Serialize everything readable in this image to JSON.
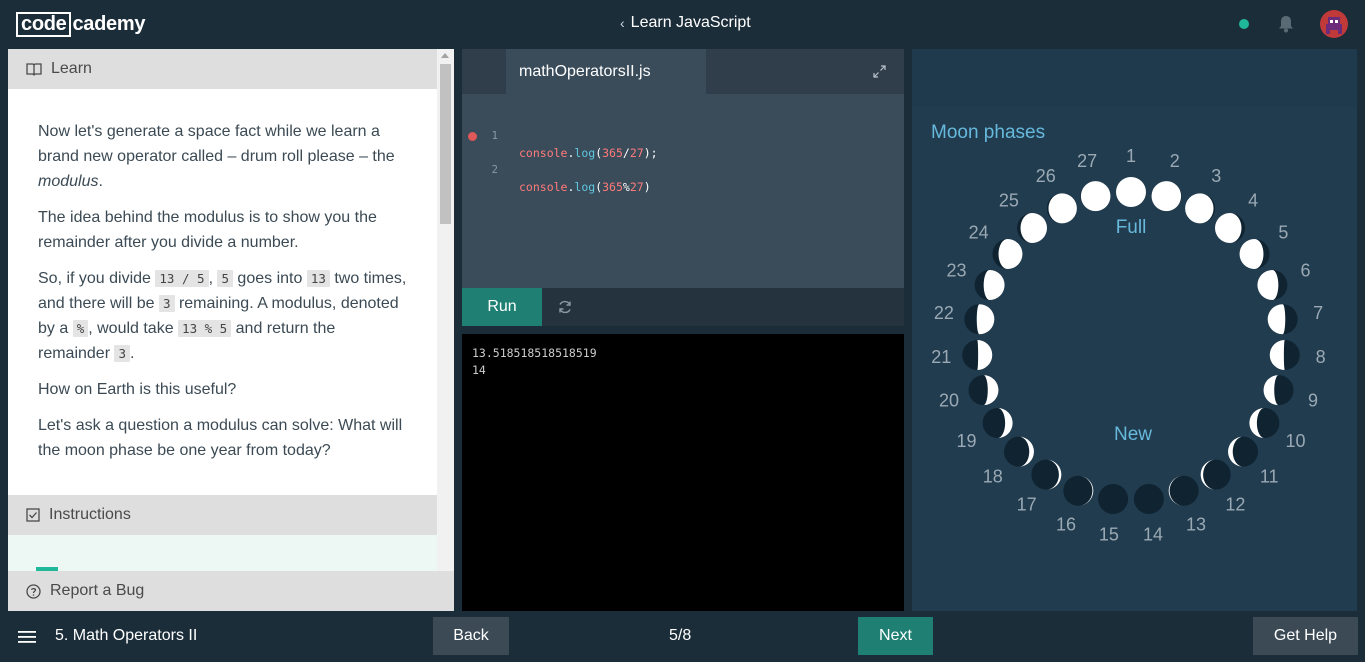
{
  "header": {
    "logo_left": "code",
    "logo_right": "cademy",
    "course_title": "Learn JavaScript"
  },
  "colors": {
    "accent": "#1e7f72",
    "status": "#1fb898",
    "moon_label": "#67b9dc"
  },
  "icons": {
    "back": "chevron-left-icon",
    "bell": "bell-icon",
    "learn": "book-icon",
    "instructions": "checkbox-icon",
    "report": "question-circle-icon",
    "expand": "expand-icon",
    "reset": "refresh-icon",
    "menu": "hamburger-icon"
  },
  "learn": {
    "header": "Learn",
    "p1_a": "Now let's generate a space fact while we learn a brand new operator called – drum roll please – the ",
    "p1_em": "modulus",
    "p1_b": ".",
    "p2": "The idea behind the modulus is to show you the remainder after you divide a number.",
    "p3_a": "So, if you divide ",
    "p3_c1": "13 / 5",
    "p3_b": ", ",
    "p3_c2": "5",
    "p3_c": " goes into ",
    "p3_c3": "13",
    "p3_d": " two times, and there will be ",
    "p3_c4": "3",
    "p3_e": " remaining. A modulus, denoted by a ",
    "p3_c5": "%",
    "p3_f": ", would take ",
    "p3_c6": "13 % 5",
    "p3_g": " and return the remainder ",
    "p3_c7": "3",
    "p3_h": ".",
    "p4": "How on Earth is this useful?",
    "p5": "Let's ask a question a modulus can solve: What will the moon phase be one year from today?"
  },
  "instructions": {
    "header": "Instructions"
  },
  "report": {
    "label": "Report a Bug"
  },
  "editor": {
    "file_name": "mathOperatorsII.js",
    "lines": [
      {
        "num": "1",
        "obj": "console",
        "dot": ".",
        "fn": "log",
        "open": "(",
        "a": "365",
        "op": "/",
        "b": "27",
        "close": ");"
      },
      {
        "num": "2",
        "obj": "console",
        "dot": ".",
        "fn": "log",
        "open": "(",
        "a": "365",
        "op": "%",
        "b": "27",
        "close": ")"
      }
    ],
    "run_label": "Run"
  },
  "console": {
    "output": [
      "13.518518518518519",
      "14"
    ]
  },
  "moon": {
    "title": "Moon phases",
    "label_full": "Full",
    "label_new": "New",
    "days": [
      "1",
      "2",
      "3",
      "4",
      "5",
      "6",
      "7",
      "8",
      "9",
      "10",
      "11",
      "12",
      "13",
      "14",
      "15",
      "16",
      "17",
      "18",
      "19",
      "20",
      "21",
      "22",
      "23",
      "24",
      "25",
      "26",
      "27"
    ]
  },
  "footer": {
    "lesson": "5. Math Operators II",
    "back_label": "Back",
    "progress": "5/8",
    "next_label": "Next",
    "help_label": "Get Help"
  }
}
